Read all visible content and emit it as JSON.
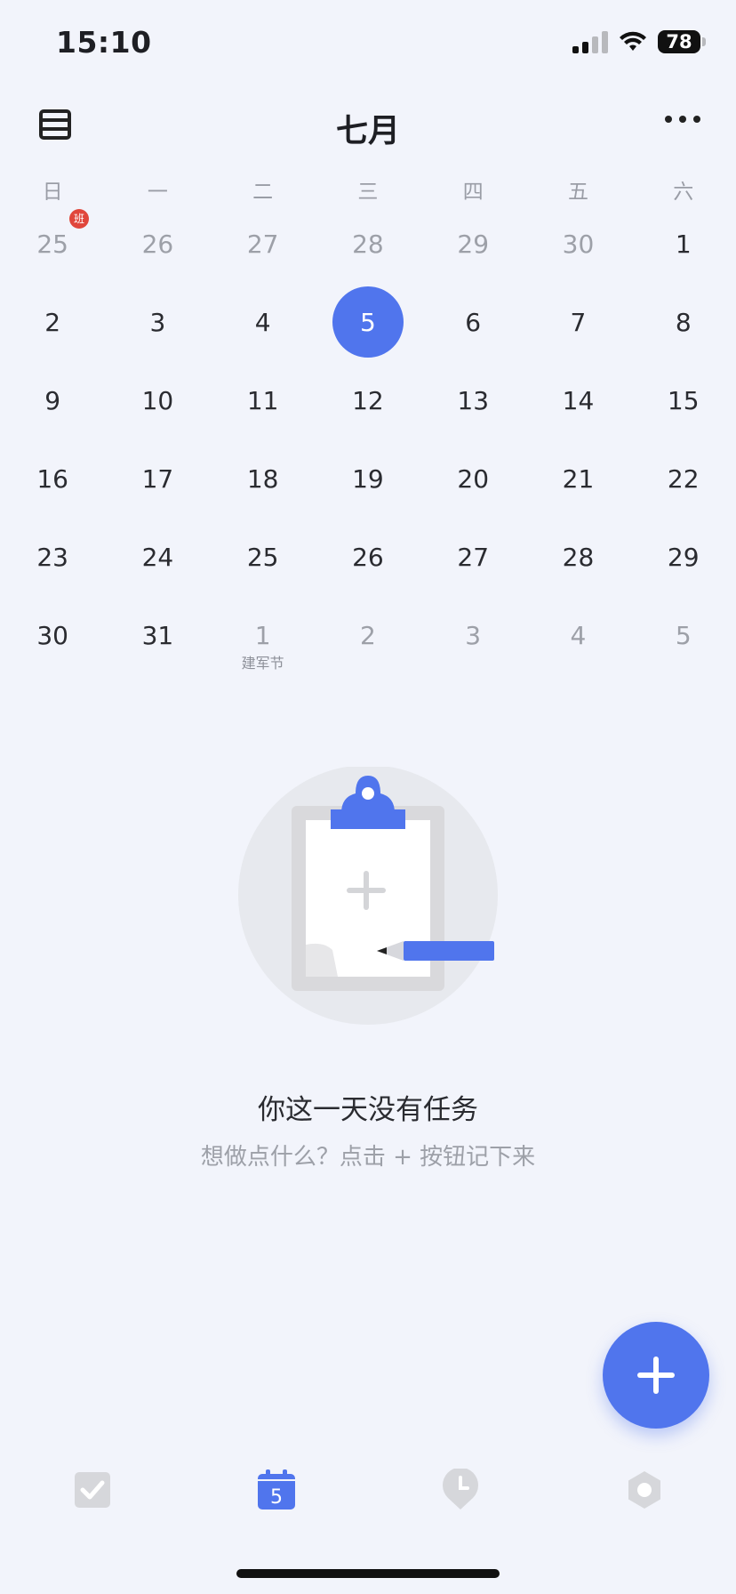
{
  "status_bar": {
    "time": "15:10",
    "battery": "78"
  },
  "header": {
    "month": "七月"
  },
  "weekdays": [
    "日",
    "一",
    "二",
    "三",
    "四",
    "五",
    "六"
  ],
  "weeks": [
    [
      {
        "d": "25",
        "other": true,
        "badge": "班"
      },
      {
        "d": "26",
        "other": true
      },
      {
        "d": "27",
        "other": true
      },
      {
        "d": "28",
        "other": true
      },
      {
        "d": "29",
        "other": true
      },
      {
        "d": "30",
        "other": true
      },
      {
        "d": "1"
      }
    ],
    [
      {
        "d": "2"
      },
      {
        "d": "3"
      },
      {
        "d": "4"
      },
      {
        "d": "5",
        "selected": true
      },
      {
        "d": "6"
      },
      {
        "d": "7"
      },
      {
        "d": "8"
      }
    ],
    [
      {
        "d": "9"
      },
      {
        "d": "10"
      },
      {
        "d": "11"
      },
      {
        "d": "12"
      },
      {
        "d": "13"
      },
      {
        "d": "14"
      },
      {
        "d": "15"
      }
    ],
    [
      {
        "d": "16"
      },
      {
        "d": "17"
      },
      {
        "d": "18"
      },
      {
        "d": "19"
      },
      {
        "d": "20"
      },
      {
        "d": "21"
      },
      {
        "d": "22"
      }
    ],
    [
      {
        "d": "23"
      },
      {
        "d": "24"
      },
      {
        "d": "25"
      },
      {
        "d": "26"
      },
      {
        "d": "27"
      },
      {
        "d": "28"
      },
      {
        "d": "29"
      }
    ],
    [
      {
        "d": "30"
      },
      {
        "d": "31"
      },
      {
        "d": "1",
        "other": true,
        "sub": "建军节"
      },
      {
        "d": "2",
        "other": true
      },
      {
        "d": "3",
        "other": true
      },
      {
        "d": "4",
        "other": true
      },
      {
        "d": "5",
        "other": true
      }
    ]
  ],
  "empty_state": {
    "title": "你这一天没有任务",
    "hint": "想做点什么？点击 + 按钮记下来"
  },
  "tabbar": {
    "calendar_day": "5",
    "icons": [
      "task-check-icon",
      "calendar-icon",
      "focus-timer-icon",
      "settings-icon"
    ]
  },
  "colors": {
    "accent": "#5075ed",
    "background": "#f2f4fb",
    "badge": "#e0463b",
    "inactive_icon": "#d6d7db"
  }
}
